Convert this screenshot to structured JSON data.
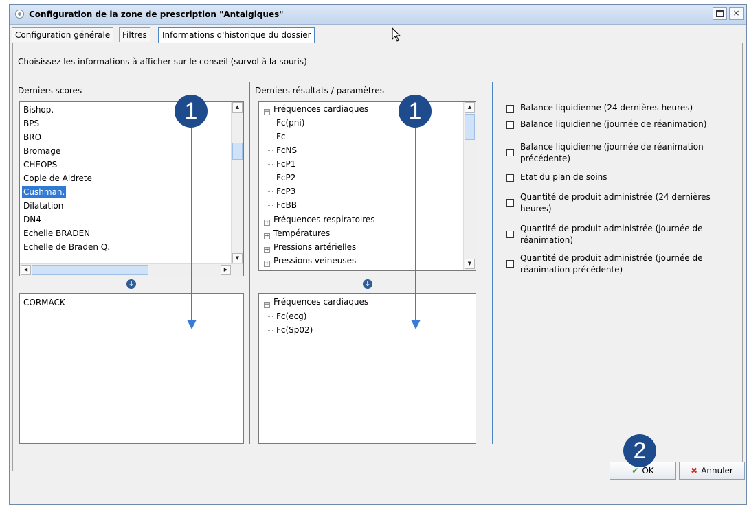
{
  "window": {
    "title": "Configuration de la zone de prescription \"Antalgiques\"",
    "maximize_label": "",
    "close_label": "×"
  },
  "tabs": [
    {
      "label": "Configuration générale"
    },
    {
      "label": "Filtres"
    },
    {
      "label": "Informations d'historique du dossier"
    }
  ],
  "instruction": "Choisissez les informations à afficher sur le conseil (survol à la souris)",
  "scores": {
    "label": "Derniers scores",
    "available": [
      "Bishop.",
      "BPS",
      "BRO",
      "Bromage",
      "CHEOPS",
      "Copie de Aldrete",
      "Cushman.",
      "Dilatation",
      "DN4",
      "Echelle BRADEN",
      "Echelle de Braden Q."
    ],
    "selected_item": "Cushman.",
    "chosen": [
      "CORMACK"
    ]
  },
  "results": {
    "label": "Derniers résultats / paramètres",
    "tree": [
      {
        "label": "Fréquences cardiaques",
        "expanded": true,
        "children": [
          "Fc(pni)",
          "Fc",
          "FcNS",
          "FcP1",
          "FcP2",
          "FcP3",
          "FcBB"
        ]
      },
      {
        "label": "Fréquences respiratoires",
        "expanded": false
      },
      {
        "label": "Températures",
        "expanded": false
      },
      {
        "label": "Pressions artérielles",
        "expanded": false
      },
      {
        "label": "Pressions veineuses",
        "expanded": false
      }
    ],
    "chosen": [
      {
        "label": "Fréquences cardiaques",
        "children": [
          "Fc(ecg)",
          "Fc(Sp02)"
        ]
      }
    ]
  },
  "options": [
    {
      "label": "Balance liquidienne (24 dernières heures)",
      "checked": false
    },
    {
      "label": "Balance liquidienne (journée de réanimation)",
      "checked": false
    },
    {
      "label": "Balance liquidienne (journée de réanimation précédente)",
      "checked": false
    },
    {
      "label": "Etat du plan de soins",
      "checked": false
    },
    {
      "label": "Quantité de produit administrée (24 dernières heures)",
      "checked": false
    },
    {
      "label": "Quantité de produit administrée (journée de réanimation)",
      "checked": false
    },
    {
      "label": "Quantité de produit administrée (journée de réanimation précédente)",
      "checked": false
    }
  ],
  "annotations": {
    "badge_1": "1",
    "badge_2": "2"
  },
  "buttons": {
    "ok": "OK",
    "cancel": "Annuler"
  },
  "colors": {
    "accent": "#4a86c8",
    "selection": "#3079d4",
    "badge": "#1e4b8c",
    "arrow": "#3a7bd5",
    "ok_icon": "#3a9a2a",
    "cancel_icon": "#d42a2a"
  },
  "icons": [
    "app-icon",
    "maximize-icon",
    "close-icon",
    "add-down-icon",
    "checkmark-icon",
    "x-icon",
    "mouse-cursor-icon"
  ]
}
